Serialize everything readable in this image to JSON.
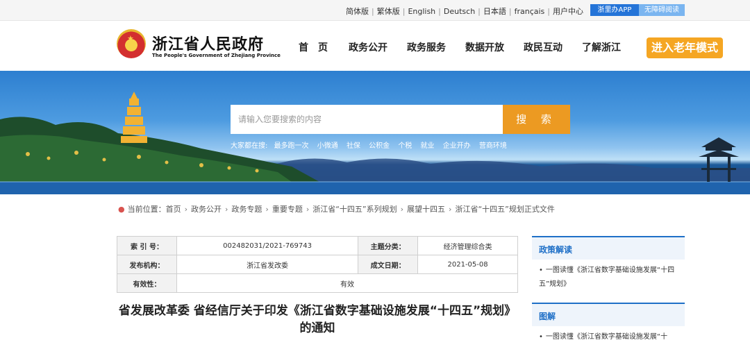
{
  "topbar": {
    "languages": [
      "简体版",
      "繁体版",
      "English",
      "Deutsch",
      "日本語",
      "français",
      "用户中心"
    ],
    "app_button": "浙里办APP",
    "barrier_button": "无障碍阅读"
  },
  "header": {
    "title": "浙江省人民政府",
    "subtitle": "The People's Government of Zhejiang Province",
    "nav": [
      "首页",
      "政务公开",
      "政务服务",
      "数据开放",
      "政民互动",
      "了解浙江"
    ],
    "elder_mode": "进入老年模式"
  },
  "search": {
    "placeholder": "请输入您要搜索的内容",
    "button": "搜 索",
    "hot_label": "大家都在搜:",
    "hot_terms": [
      "最多跑一次",
      "小微通",
      "社保",
      "公积金",
      "个税",
      "就业",
      "企业开办",
      "营商环境"
    ]
  },
  "breadcrumb": {
    "label": "当前位置：",
    "items": [
      "首页",
      "政务公开",
      "政务专题",
      "重要专题",
      "浙江省“十四五”系列规划",
      "展望十四五",
      "浙江省“十四五”规划正式文件"
    ]
  },
  "info": {
    "index_label": "索 引 号：",
    "index_value": "002482031/2021-769743",
    "topic_label": "主题分类：",
    "topic_value": "经济管理综合类",
    "org_label": "发布机构：",
    "org_value": "浙江省发改委",
    "date_label": "成文日期：",
    "date_value": "2021-05-08",
    "validity_label": "有效性：",
    "validity_value": "有效"
  },
  "article": {
    "title": "省发展改革委 省经信厅关于印发《浙江省数字基础设施发展“十四五”规划》的通知"
  },
  "side": {
    "policy_head": "政策解读",
    "policy_item": "一图读懂《浙江省数字基础设施发展“十四五”规划》",
    "graphic_head": "图解",
    "graphic_item": "一图读懂《浙江省数字基础设施发展“十"
  },
  "colors": {
    "accent_blue": "#1e6fc7",
    "orange": "#ec9a22"
  }
}
